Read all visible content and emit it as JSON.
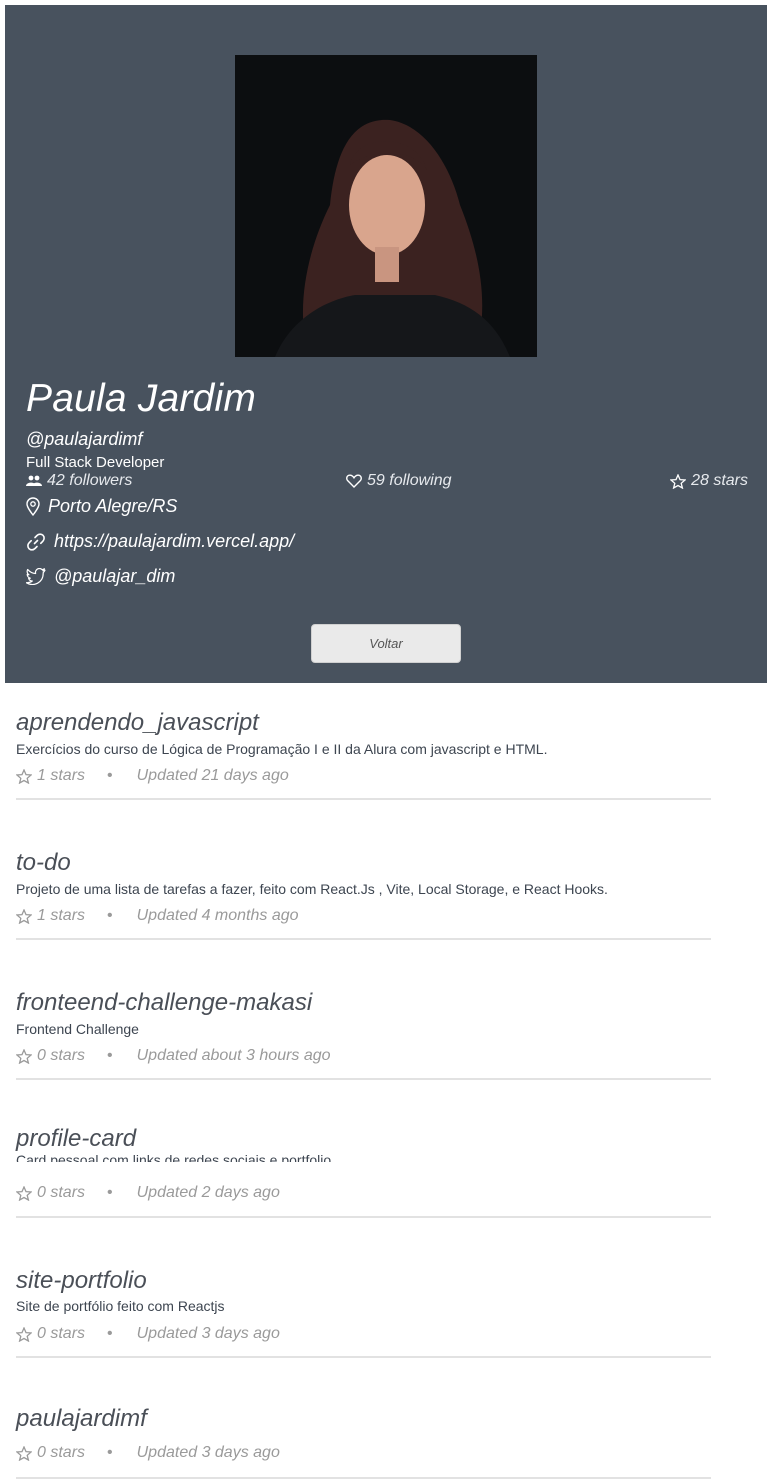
{
  "profile": {
    "name": "Paula Jardim",
    "login": "@paulajardimf",
    "bio": "Full Stack Developer",
    "followers": "42 followers",
    "following": "59 following",
    "stars": "28 stars",
    "location": "Porto Alegre/RS",
    "website": "https://paulajardim.vercel.app/",
    "twitter": "@paulajar_dim",
    "back_label": "Voltar"
  },
  "repos": [
    {
      "name": "aprendendo_javascript",
      "description": "Exercícios do curso de Lógica de Programação I e II da Alura com javascript e HTML.",
      "stars": "1 stars",
      "updated": "Updated 21 days ago"
    },
    {
      "name": "to-do",
      "description": "Projeto de uma lista de tarefas a fazer, feito com React.Js , Vite, Local Storage, e React Hooks.",
      "stars": "1 stars",
      "updated": "Updated 4 months ago"
    },
    {
      "name": "fronteend-challenge-makasi",
      "description": "Frontend Challenge",
      "stars": "0 stars",
      "updated": "Updated about 3 hours ago"
    },
    {
      "name": "profile-card",
      "description": "Card pessoal com links de redes sociais e portfolio.",
      "stars": "0 stars",
      "updated": "Updated 2 days ago"
    },
    {
      "name": "site-portfolio",
      "description": "Site de portfólio feito com Reactjs",
      "stars": "0 stars",
      "updated": "Updated 3 days ago"
    },
    {
      "name": "paulajardimf",
      "description": "",
      "stars": "0 stars",
      "updated": "Updated 3 days ago"
    }
  ],
  "separator": "•",
  "icons": {
    "followers": "people-icon",
    "following": "heart-icon",
    "stars": "star-icon",
    "location": "location-pin-icon",
    "website": "link-icon",
    "twitter": "twitter-icon"
  },
  "colors": {
    "header_bg": "#48525e",
    "button_bg": "#eaeaea",
    "muted_text": "#9a9a9a"
  }
}
